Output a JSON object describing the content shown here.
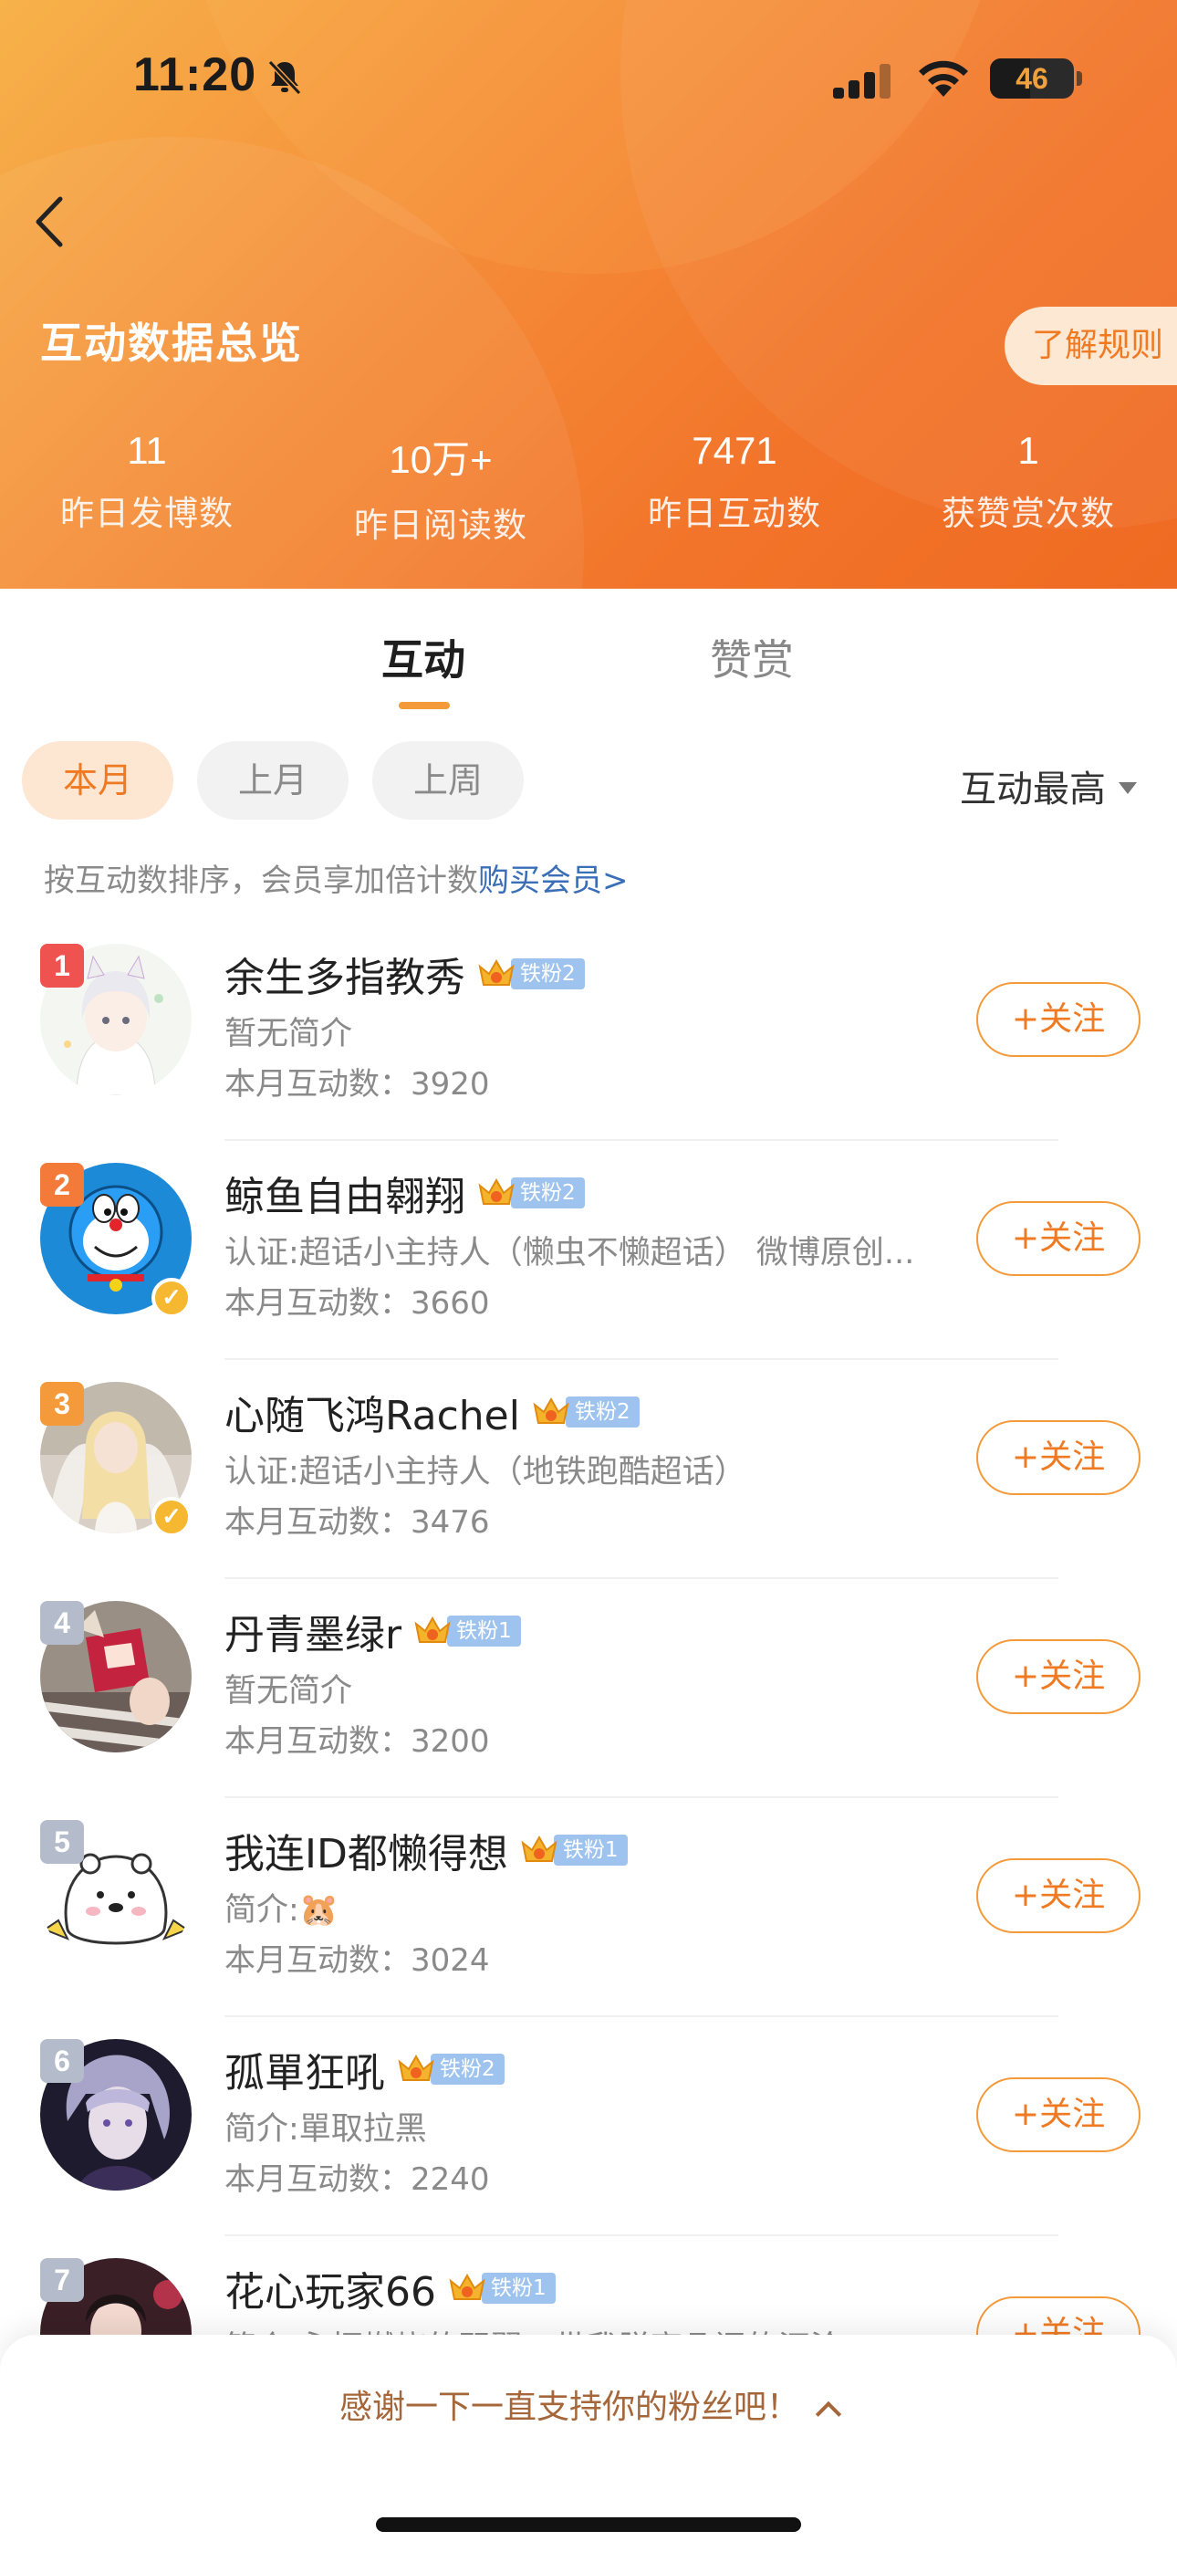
{
  "status_bar": {
    "time": "11:20",
    "battery": "46"
  },
  "header": {
    "title": "互动数据总览",
    "rules_label": "了解规则",
    "stats": [
      {
        "value": "11",
        "label": "昨日发博数"
      },
      {
        "value": "10万+",
        "label": "昨日阅读数"
      },
      {
        "value": "7471",
        "label": "昨日互动数"
      },
      {
        "value": "1",
        "label": "获赞赏次数"
      }
    ]
  },
  "tabs": [
    {
      "label": "互动",
      "active": true
    },
    {
      "label": "赞赏",
      "active": false
    }
  ],
  "filters": {
    "chips": [
      {
        "label": "本月",
        "active": true
      },
      {
        "label": "上月",
        "active": false
      },
      {
        "label": "上周",
        "active": false
      }
    ],
    "sort_label": "互动最高"
  },
  "hint": {
    "text": "按互动数排序，会员享加倍计数",
    "link": "购买会员>"
  },
  "follow_label": "+关注",
  "users": [
    {
      "rank": "1",
      "name": "余生多指教秀",
      "fan_level": "铁粉2",
      "bio": "暂无简介",
      "count": "本月互动数：3920",
      "verified": false
    },
    {
      "rank": "2",
      "name": "鲸鱼自由翱翔",
      "fan_level": "铁粉2",
      "bio": "认证:超话小主持人（懒虫不懒超话） 微博原创...",
      "count": "本月互动数：3660",
      "verified": true
    },
    {
      "rank": "3",
      "name": "心随飞鸿Rachel",
      "fan_level": "铁粉2",
      "bio": "认证:超话小主持人（地铁跑酷超话）",
      "count": "本月互动数：3476",
      "verified": true
    },
    {
      "rank": "4",
      "name": "丹青墨绿r",
      "fan_level": "铁粉1",
      "bio": "暂无简介",
      "count": "本月互动数：3200",
      "verified": false
    },
    {
      "rank": "5",
      "name": "我连ID都懒得想",
      "fan_level": "铁粉1",
      "bio": "简介:🐹",
      "count": "本月互动数：3024",
      "verified": false
    },
    {
      "rank": "6",
      "name": "孤單狂吼",
      "fan_level": "铁粉2",
      "bio": "简介:單取拉黑",
      "count": "本月互动数：2240",
      "verified": false
    },
    {
      "rank": "7",
      "name": "花心玩家66",
      "fan_level": "铁粉1",
      "bio": "简介:永恒燃烧的羽翼，带我脱离凡间的沉沦",
      "count": "",
      "verified": false
    }
  ],
  "bottom_sheet": {
    "text": "感谢一下一直支持你的粉丝吧！"
  },
  "colors": {
    "accent": "#f07a22",
    "rank_top": "#ef5350",
    "rank_2": "#f47a3a",
    "rank_3": "#f59a3a",
    "rank_other": "#b4bccb"
  }
}
